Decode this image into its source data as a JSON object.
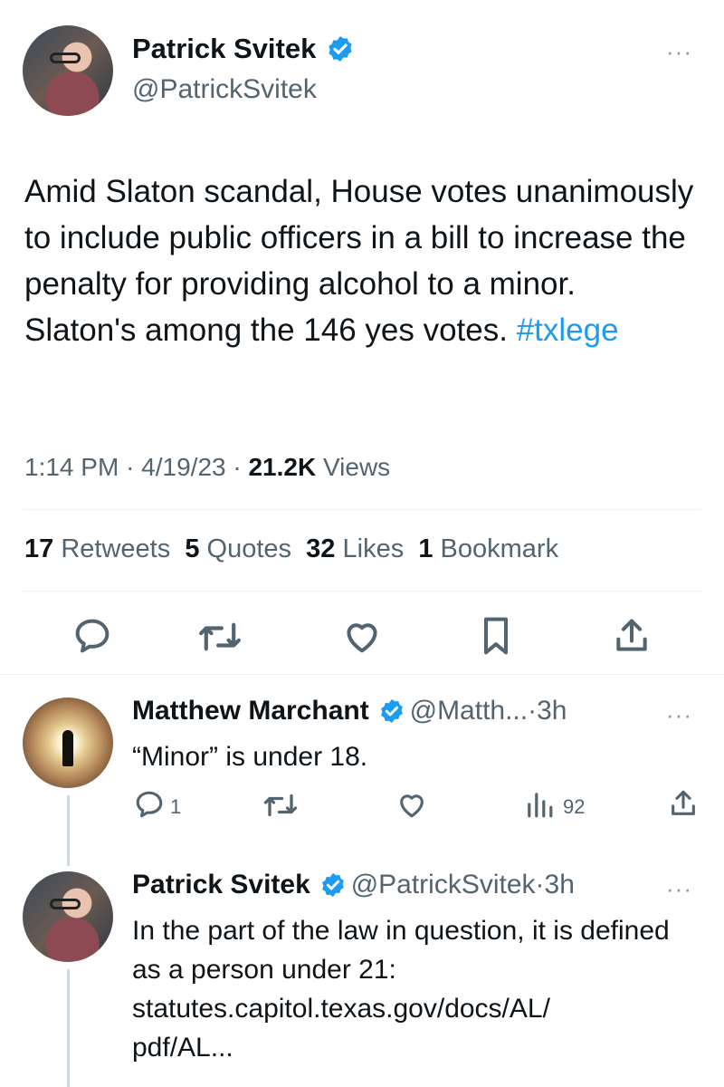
{
  "main_tweet": {
    "author_name": "Patrick Svitek",
    "author_handle": "@PatrickSvitek",
    "text_before_link": "Amid Slaton scandal, House votes unanimously to include public officers in a bill to increase the penalty for providing alcohol to a minor. Slaton's among the 146 yes votes.",
    "hashtag": "#txlege",
    "time": "1:14 PM",
    "date": "4/19/23",
    "views_count": "21.2K",
    "views_label": "Views",
    "retweets_count": "17",
    "retweets_label": "Retweets",
    "quotes_count": "5",
    "quotes_label": "Quotes",
    "likes_count": "32",
    "likes_label": "Likes",
    "bookmarks_count": "1",
    "bookmarks_label": "Bookmark",
    "more_label": "···"
  },
  "replies": [
    {
      "author_name": "Matthew Marchant",
      "author_handle": "@Matth...",
      "time": "3h",
      "text": "“Minor” is under 18.",
      "reply_count": "1",
      "views_count": "92",
      "more_label": "···"
    },
    {
      "author_name": "Patrick Svitek",
      "author_handle": "@PatrickSvitek",
      "time": "3h",
      "text": "In the part of the law in question, it is defined as a person under 21:",
      "link_line1": "statutes.capitol.texas.gov/docs/AL/",
      "link_line2": "pdf/AL...",
      "more_label": "···"
    }
  ],
  "separator": "·",
  "colors": {
    "accent": "#1d9bf0",
    "text": "#0f1419",
    "secondary": "#536471",
    "divider": "#eff3f4"
  },
  "icons": [
    "verified-badge-icon",
    "more-icon",
    "reply-icon",
    "retweet-icon",
    "like-icon",
    "bookmark-icon",
    "share-icon",
    "views-icon"
  ]
}
